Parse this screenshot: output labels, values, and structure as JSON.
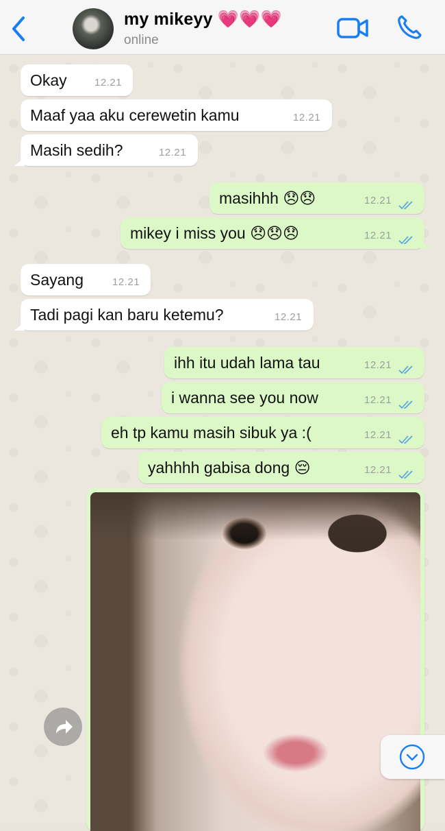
{
  "header": {
    "back_icon": "chevron-left-icon",
    "contact_name": "my mikeyy 💗💗💗",
    "status": "online",
    "video_icon": "video-camera-icon",
    "call_icon": "phone-icon"
  },
  "messages": [
    {
      "dir": "in",
      "text": "Okay",
      "time": "12.21"
    },
    {
      "dir": "in",
      "text": "Maaf yaa aku cerewetin kamu",
      "time": "12.21"
    },
    {
      "dir": "in",
      "text": "Masih sedih?",
      "time": "12.21"
    },
    {
      "dir": "out",
      "text": "masihhh 😞😞",
      "time": "12.21",
      "read": true
    },
    {
      "dir": "out",
      "text": "mikey i miss you 😞😞😞",
      "time": "12.21",
      "read": true
    },
    {
      "dir": "in",
      "text": "Sayang",
      "time": "12.21"
    },
    {
      "dir": "in",
      "text": "Tadi pagi kan baru ketemu?",
      "time": "12.21"
    },
    {
      "dir": "out",
      "text": "ihh itu udah lama tau",
      "time": "12.21",
      "read": true
    },
    {
      "dir": "out",
      "text": "i wanna see you now",
      "time": "12.21",
      "read": true
    },
    {
      "dir": "out",
      "text": "eh tp kamu masih sibuk ya :(",
      "time": "12.21",
      "read": true
    },
    {
      "dir": "out",
      "text": "yahhhh gabisa dong 😔",
      "time": "12.21",
      "read": true
    }
  ],
  "photo_message": {
    "dir": "out",
    "content": "selfie photo"
  },
  "controls": {
    "forward_icon": "forward-icon",
    "scroll_down_icon": "chevron-down-circle-icon"
  },
  "colors": {
    "outgoing_bubble": "#dcf8c6",
    "incoming_bubble": "#ffffff",
    "accent": "#1a7ef2",
    "read_ticks": "#4fa3e0"
  }
}
